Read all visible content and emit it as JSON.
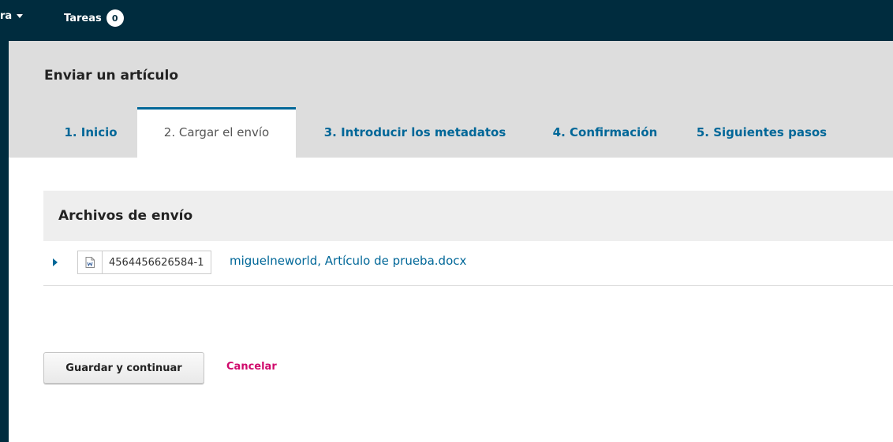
{
  "topbar": {
    "menu_label": "ra",
    "tasks_label": "Tareas",
    "tasks_count": "0"
  },
  "page": {
    "title": "Enviar un artículo"
  },
  "tabs": [
    {
      "label": "1. Inicio"
    },
    {
      "label": "2. Cargar el envío",
      "active": true
    },
    {
      "label": "3. Introducir los metadatos"
    },
    {
      "label": "4. Confirmación"
    },
    {
      "label": "5. Siguientes pasos"
    }
  ],
  "files_panel": {
    "title": "Archivos de envío",
    "files": [
      {
        "id": "4564456626584-1",
        "name": "miguelneworld, Artículo de prueba.docx",
        "icon": "word-document-icon"
      }
    ]
  },
  "actions": {
    "save_label": "Guardar y continuar",
    "cancel_label": "Cancelar"
  },
  "colors": {
    "topbar": "#002c3e",
    "link": "#006798",
    "cancel": "#d00a6c",
    "header_bg": "#dddddd"
  }
}
